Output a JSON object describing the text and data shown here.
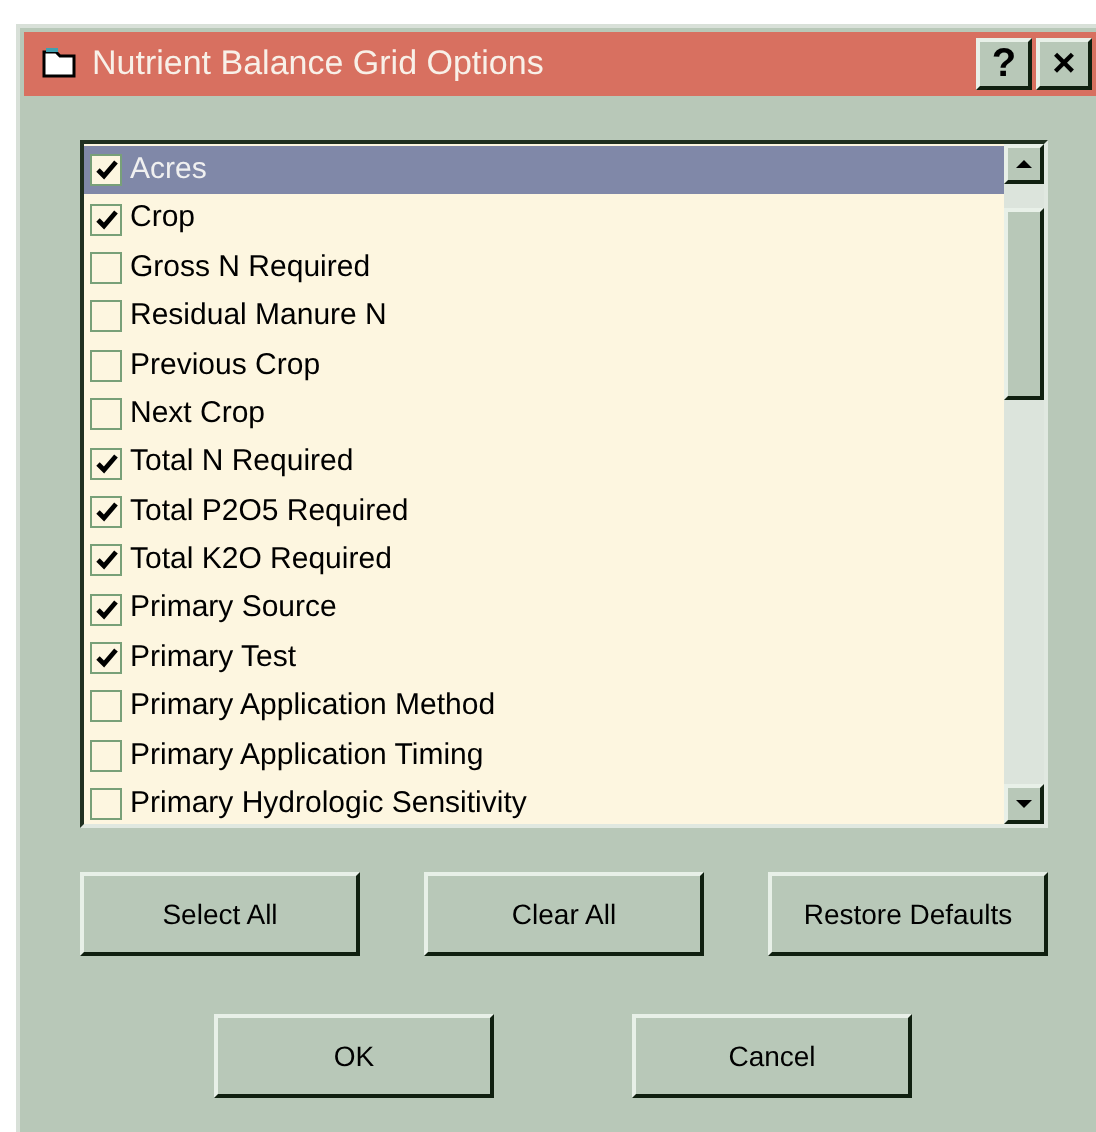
{
  "window": {
    "title": "Nutrient Balance Grid Options"
  },
  "title_buttons": [
    "?",
    "×"
  ],
  "columns": [
    {
      "label": "Acres",
      "checked": true,
      "selected": true
    },
    {
      "label": "Crop",
      "checked": true,
      "selected": false
    },
    {
      "label": "Gross N Required",
      "checked": false,
      "selected": false
    },
    {
      "label": "Residual Manure N",
      "checked": false,
      "selected": false
    },
    {
      "label": "Previous Crop",
      "checked": false,
      "selected": false
    },
    {
      "label": "Next Crop",
      "checked": false,
      "selected": false
    },
    {
      "label": "Total N Required",
      "checked": true,
      "selected": false
    },
    {
      "label": "Total P2O5 Required",
      "checked": true,
      "selected": false
    },
    {
      "label": "Total K2O Required",
      "checked": true,
      "selected": false
    },
    {
      "label": "Primary Source",
      "checked": true,
      "selected": false
    },
    {
      "label": "Primary Test",
      "checked": true,
      "selected": false
    },
    {
      "label": "Primary Application Method",
      "checked": false,
      "selected": false
    },
    {
      "label": "Primary Application Timing",
      "checked": false,
      "selected": false
    },
    {
      "label": "Primary Hydrologic Sensitivity",
      "checked": false,
      "selected": false
    }
  ],
  "action_buttons": [
    "Select All",
    "Clear All",
    "Restore Defaults"
  ],
  "dialog_buttons": [
    "OK",
    "Cancel"
  ]
}
